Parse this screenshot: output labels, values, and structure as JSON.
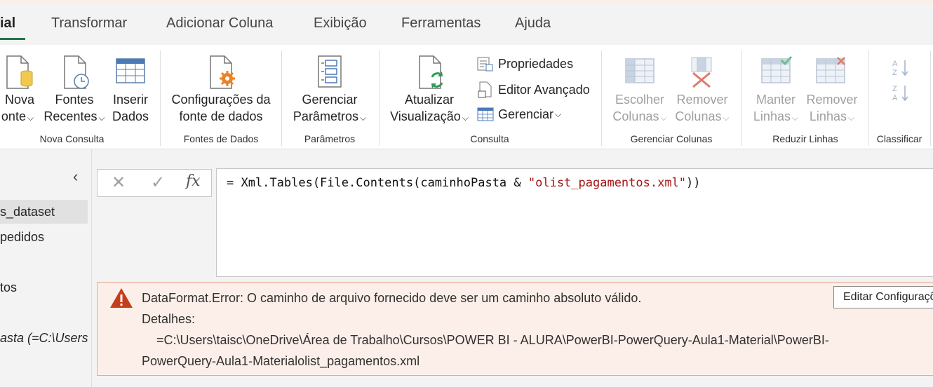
{
  "tabs": [
    "ial",
    "Transformar",
    "Adicionar Coluna",
    "Exibição",
    "Ferramentas",
    "Ajuda"
  ],
  "ribbon": {
    "nova_fonte": [
      "Nova",
      "onte"
    ],
    "fontes_recentes": [
      "Fontes",
      "Recentes"
    ],
    "inserir_dados": [
      "Inserir",
      "Dados"
    ],
    "group_nova_consulta": "Nova Consulta",
    "config_fonte": [
      "Configurações da",
      "fonte de dados"
    ],
    "group_fontes_dados": "Fontes de Dados",
    "gerenciar_param": [
      "Gerenciar",
      "Parâmetros"
    ],
    "group_parametros": "Parâmetros",
    "atualizar": [
      "Atualizar",
      "Visualização"
    ],
    "propriedades": "Propriedades",
    "editor_avancado": "Editor Avançado",
    "gerenciar": "Gerenciar",
    "group_consulta": "Consulta",
    "escolher_colunas": [
      "Escolher",
      "Colunas"
    ],
    "remover_colunas": [
      "Remover",
      "Colunas"
    ],
    "group_gerenciar_colunas": "Gerenciar Colunas",
    "manter_linhas": [
      "Manter",
      "Linhas"
    ],
    "remover_linhas": [
      "Remover",
      "Linhas"
    ],
    "group_reduzir_linhas": "Reduzir Linhas",
    "group_classificar": "Classificar"
  },
  "queries": [
    "s_dataset",
    "pedidos",
    "tos",
    "asta (=C:\\Users..."
  ],
  "formula": {
    "prefix": "= Xml.Tables(File.Contents(caminhoPasta & ",
    "string": "\"olist_pagamentos.xml\"",
    "suffix": "))"
  },
  "error": {
    "message": "DataFormat.Error: O caminho de arquivo fornecido deve ser um caminho absoluto válido.",
    "details_label": "Detalhes:",
    "details_line1": "=C:\\Users\\taisc\\OneDrive\\Área de Trabalho\\Cursos\\POWER BI - ALURA\\PowerBI-PowerQuery-Aula1-Material\\PowerBI-",
    "details_line2": "PowerQuery-Aula1-Materialolist_pagamentos.xml",
    "edit_button": "Editar Configurações"
  }
}
